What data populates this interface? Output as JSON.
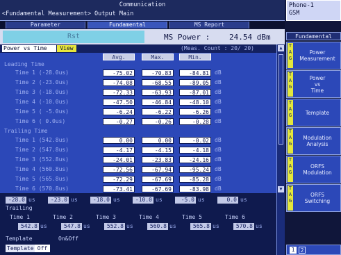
{
  "header": {
    "title": "Communication",
    "subtitle": "<Fundamental Measurement> Output Main",
    "phone_line1": "Phone-1",
    "phone_line2": "GSM"
  },
  "tabs": [
    {
      "label": "Parameter",
      "active": false
    },
    {
      "label": "Fundamental",
      "active": true
    },
    {
      "label": "MS Report",
      "active": false
    }
  ],
  "status": {
    "rst_label": "Rst",
    "ms_power_label": "MS Power :",
    "ms_power_value": "24.54 dBm"
  },
  "panel": {
    "mode_label": "Power vs Time",
    "view_label": "View",
    "meas_count": "(Meas. Count :     20/  20)",
    "columns": [
      "Avg.",
      "Max.",
      "Min."
    ],
    "unit": "dB",
    "leading_title": "Leading Time",
    "leading_rows": [
      {
        "label": "Time 1 (-28.0us)",
        "avg": "-75.02",
        "max": "-70.83",
        "min": "-84.81"
      },
      {
        "label": "Time 2 (-23.0us)",
        "avg": "-74.08",
        "max": "-68.55",
        "min": "-89.05"
      },
      {
        "label": "Time 3 (-18.0us)",
        "avg": "-72.33",
        "max": "-63.93",
        "min": "-87.01"
      },
      {
        "label": "Time 4 (-10.0us)",
        "avg": "-47.50",
        "max": "-46.84",
        "min": "-48.10"
      },
      {
        "label": "Time 5 ( -5.0us)",
        "avg": "-6.24",
        "max": "-6.22",
        "min": "-6.26"
      },
      {
        "label": "Time 6 (  0.0us)",
        "avg": "-0.27",
        "max": "-0.26",
        "min": "-0.28"
      }
    ],
    "trailing_title": "Trailing Time",
    "trailing_rows": [
      {
        "label": "Time 1 (542.8us)",
        "avg": "0.00",
        "max": "0.00",
        "min": "-0.02"
      },
      {
        "label": "Time 2 (547.8us)",
        "avg": "-4.17",
        "max": "-4.15",
        "min": "-4.18"
      },
      {
        "label": "Time 3 (552.8us)",
        "avg": "-24.01",
        "max": "-23.83",
        "min": "-24.16"
      },
      {
        "label": "Time 4 (560.8us)",
        "avg": "-72.56",
        "max": "-67.94",
        "min": "-95.24"
      },
      {
        "label": "Time 5 (565.8us)",
        "avg": "-72.29",
        "max": "-67.69",
        "min": "-85.28"
      },
      {
        "label": "Time 6 (570.8us)",
        "avg": "-73.41",
        "max": "-67.69",
        "min": "-83.98"
      }
    ]
  },
  "lower": {
    "leading_values": [
      "-28.0",
      "-23.0",
      "-18.0",
      "-10.0",
      "-5.0",
      "0.0"
    ],
    "unit": "us",
    "trailing_title": "Trailing",
    "trailing_headers": [
      "Time 1",
      "Time 2",
      "Time 3",
      "Time 4",
      "Time 5",
      "Time 6"
    ],
    "trailing_values": [
      "542.8",
      "547.8",
      "552.8",
      "560.8",
      "565.8",
      "570.8"
    ],
    "template_label": "Template",
    "template_onoff": "On&Off",
    "template_button": "Template",
    "template_value": "Off"
  },
  "softkeys": {
    "header": "Fundamental",
    "tag": "T\nA\nG",
    "items": [
      "Power\nMeasurement",
      "Power\nvs\nTime",
      "Template",
      "Modulation\nAnalysis",
      "ORFS\nModulation",
      "ORFS\nSwitching"
    ],
    "pages": [
      "1",
      "2"
    ]
  },
  "colors": {
    "panel_bg": "#2c48b8",
    "header_bg": "#1d2a5e",
    "status_bg": "#d7dcf0",
    "highlight": "#e8e63a",
    "rst_bg": "#7fd0e6"
  }
}
